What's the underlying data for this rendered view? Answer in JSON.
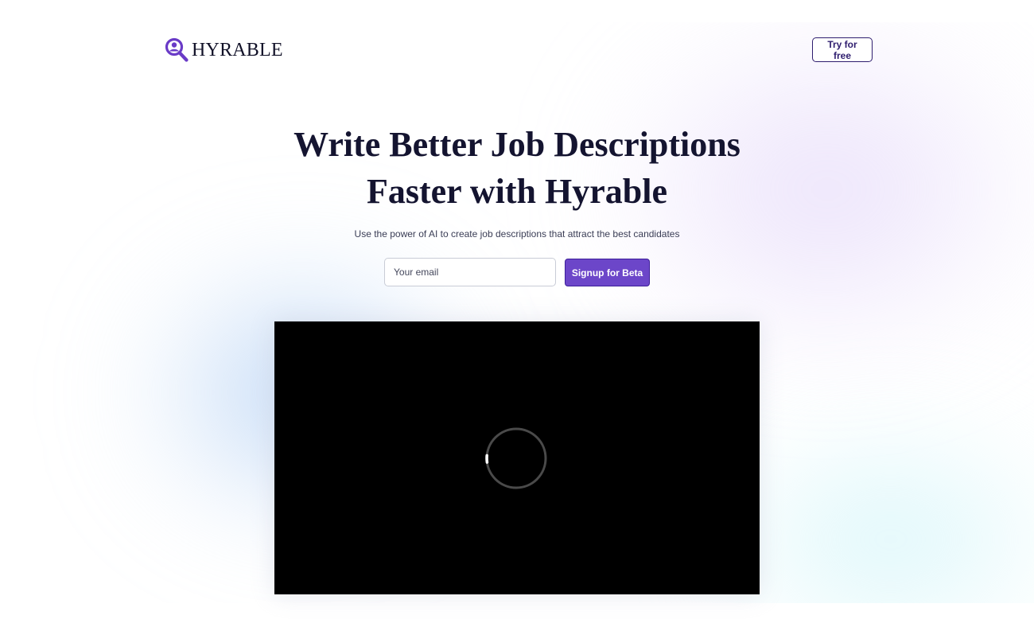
{
  "brand": {
    "name": "HYRABLE",
    "icon": "magnifier-user-icon",
    "color": "#6a3bc7"
  },
  "header": {
    "cta_label": "Try for free"
  },
  "hero": {
    "title_line1": "Write Better Job Descriptions",
    "title_line2": "Faster with Hyrable",
    "subtitle": "Use the power of AI to create job descriptions that attract the best candidates"
  },
  "signup": {
    "email_placeholder": "Your email",
    "email_value": "",
    "button_label": "Signup for Beta",
    "button_color": "#6c46c9"
  },
  "video": {
    "state": "loading",
    "icon": "loading-spinner-icon",
    "background": "#000000"
  }
}
